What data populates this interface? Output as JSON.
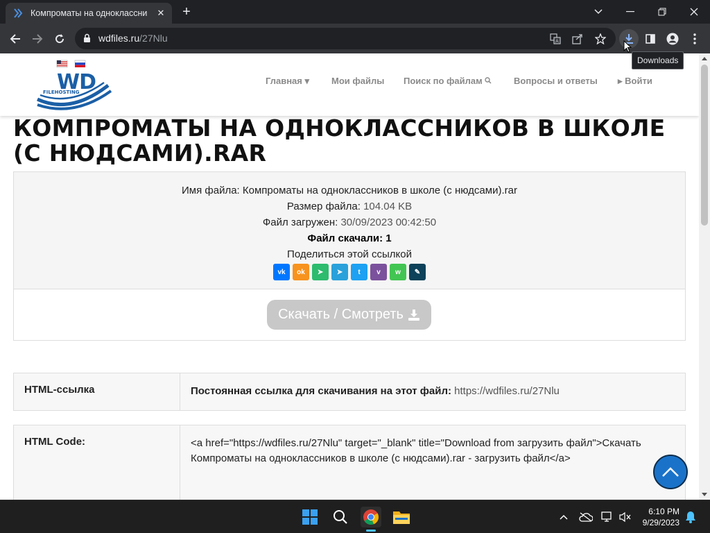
{
  "browser": {
    "tab_title": "Компроматы на одноклассник",
    "url_host": "wdfiles.ru",
    "url_path": "/27Nlu",
    "tooltip": "Downloads",
    "minimize": "—",
    "close_tab": "✕",
    "new_tab": "+"
  },
  "site": {
    "logo_text": "WD",
    "logo_subtext": "FILEHOSTING",
    "nav": [
      {
        "label": "Главная ▾"
      },
      {
        "label": "Мои файлы"
      },
      {
        "label": "Поиск по файлам"
      },
      {
        "label": "Вопросы и ответы"
      },
      {
        "label": "▸ Войти"
      }
    ]
  },
  "file": {
    "heading": "КОМПРОМАТЫ НА ОДНОКЛАССНИКОВ В ШКОЛЕ (С НЮДСАМИ).RAR",
    "name_label": "Имя файла:",
    "name_value": "Компроматы на одноклассников в школе (с нюдсами).rar",
    "size_label": "Размер файла:",
    "size_value": "104.04 KB",
    "uploaded_label": "Файл загружен:",
    "uploaded_value": "30/09/2023 00:42:50",
    "downloads_label": "Файл скачали: 1",
    "share_label": "Поделиться этой ссылкой",
    "share_buttons": [
      {
        "name": "vk",
        "text": "vk",
        "color": "#0077ff"
      },
      {
        "name": "ok",
        "text": "ok",
        "color": "#f7931e"
      },
      {
        "name": "send",
        "text": "➤",
        "color": "#2dbb6e"
      },
      {
        "name": "telegram",
        "text": "➤",
        "color": "#2aa1da"
      },
      {
        "name": "twitter",
        "text": "t",
        "color": "#1da1f2"
      },
      {
        "name": "viber",
        "text": "v",
        "color": "#7b519d"
      },
      {
        "name": "whatsapp",
        "text": "w",
        "color": "#43c553"
      },
      {
        "name": "livejournal",
        "text": "✎",
        "color": "#0d425a"
      }
    ],
    "download_button": "Скачать / Смотреть"
  },
  "links": {
    "html_link_label": "HTML-ссылка",
    "html_link_prefix": "Постоянная ссылка для скачивания на этот файл:",
    "html_link_url": "https://wdfiles.ru/27Nlu",
    "html_code_label": "HTML Code:",
    "html_code_value": "<a href=\"https://wdfiles.ru/27Nlu\" target=\"_blank\" title=\"Download from загрузить файл\">Скачать Компроматы на одноклассников в школе (с нюдсами).rar - загрузить файл</a>"
  },
  "taskbar": {
    "time": "6:10 PM",
    "date": "9/29/2023"
  }
}
